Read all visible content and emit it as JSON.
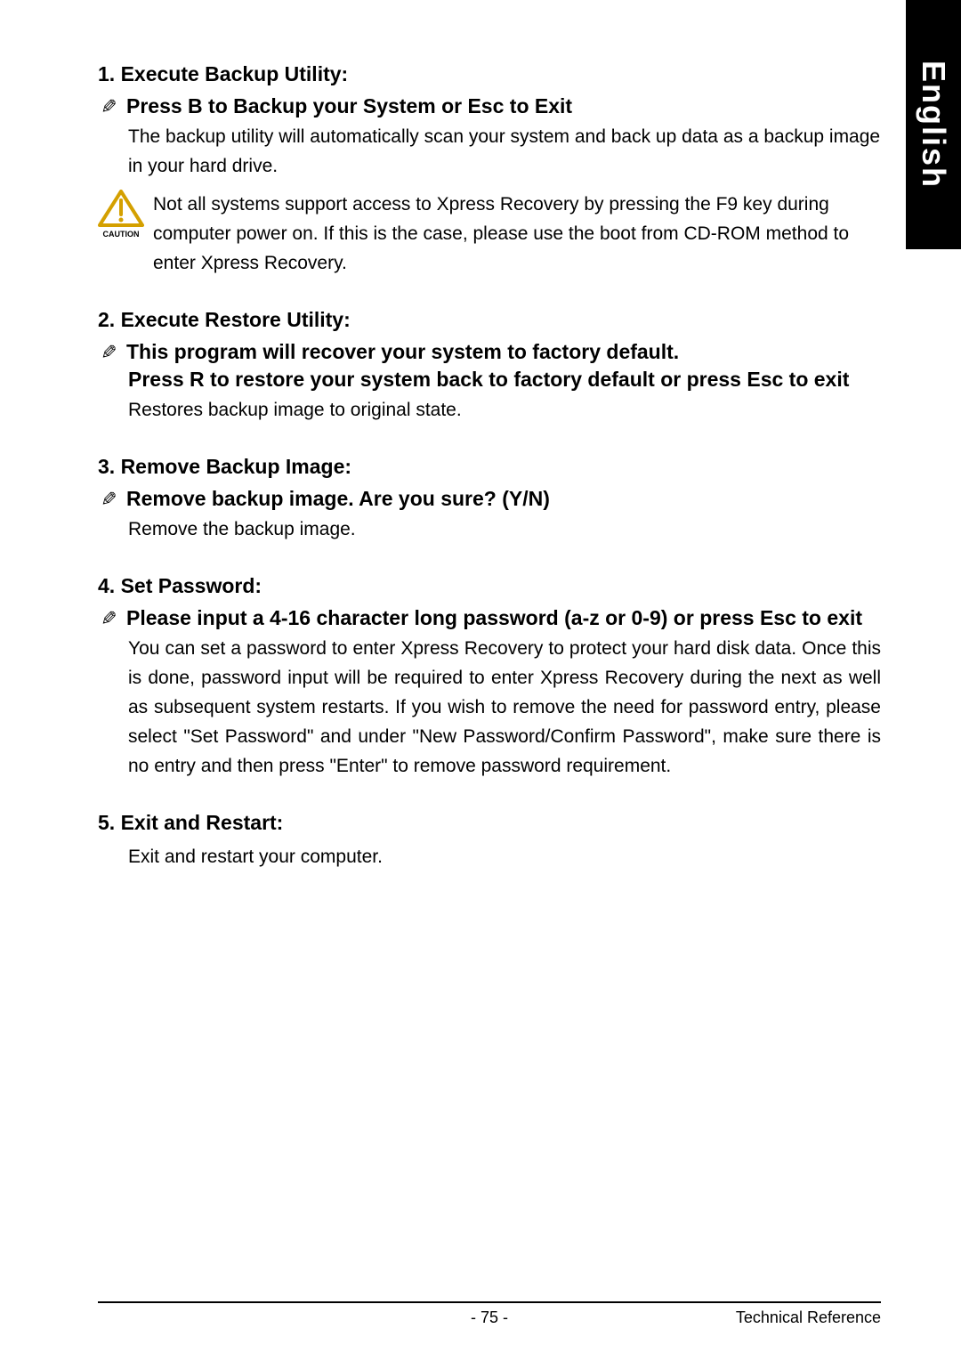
{
  "sideTab": "English",
  "sections": {
    "s1": {
      "title": "1. Execute Backup Utility:",
      "sub": "Press B to Backup your System or Esc to Exit",
      "body": "The backup utility will automatically scan your system and back up data as a backup image in your hard drive.",
      "caution": "Not all systems support access to Xpress Recovery by pressing the F9 key during computer power on. If this is the case, please use the boot from CD-ROM method to enter Xpress Recovery.",
      "cautionLabel": "CAUTION"
    },
    "s2": {
      "title": "2. Execute Restore Utility:",
      "sub": "This program will recover your system to factory default.",
      "sub2": "Press R to restore your system back to factory default or press Esc to exit",
      "body": "Restores backup image to original state."
    },
    "s3": {
      "title": "3. Remove Backup Image:",
      "sub": "Remove backup image.  Are you sure?  (Y/N)",
      "body": "Remove the backup image."
    },
    "s4": {
      "title": "4. Set Password:",
      "sub": "Please input a 4-16 character long password (a-z or 0-9) or press Esc to exit",
      "body": "You can set a password to enter Xpress Recovery to protect your hard disk data.  Once this is done, password input will be required to enter Xpress Recovery during the next as well as subsequent system restarts.  If you wish to remove the need for password entry, please select \"Set Password\" and under \"New Password/Confirm Password\", make sure there is no entry and then press \"Enter\" to remove password requirement."
    },
    "s5": {
      "title": "5. Exit and Restart:",
      "body": "Exit and restart your computer."
    }
  },
  "footer": {
    "pageNum": "- 75 -",
    "docRef": "Technical Reference"
  }
}
